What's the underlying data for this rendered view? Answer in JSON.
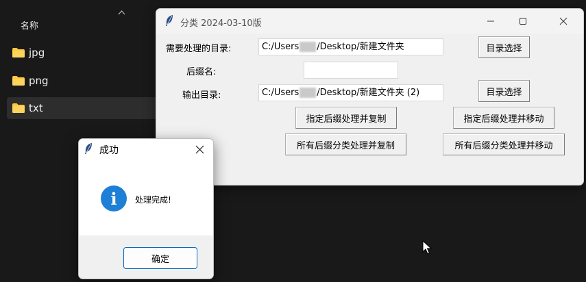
{
  "explorer": {
    "column_header": "名称",
    "files": [
      {
        "name": "jpg",
        "selected": false
      },
      {
        "name": "png",
        "selected": false
      },
      {
        "name": "txt",
        "selected": true
      }
    ],
    "folder_color": "#ffc83d"
  },
  "main_window": {
    "title": "分类 2024-03-10版",
    "labels": {
      "source_dir": "需要处理的目录:",
      "suffix": "后缀名:",
      "output_dir": "输出目录:"
    },
    "source_path_prefix": "C:/Users",
    "source_path_suffix": "/Desktop/新建文件夹",
    "suffix_value": "",
    "output_path_prefix": "C:/Users",
    "output_path_suffix": "/Desktop/新建文件夹 (2)",
    "buttons": {
      "browse_source": "目录选择",
      "browse_output": "目录选择",
      "copy_by_suffix": "指定后缀处理并复制",
      "move_by_suffix": "指定后缀处理并移动",
      "copy_all": "所有后缀分类处理并复制",
      "move_all": "所有后缀分类处理并移动"
    }
  },
  "dialog": {
    "title": "成功",
    "message": "处理完成!",
    "ok_label": "确定",
    "icon": "info-icon",
    "accent": "#1d7fd6"
  }
}
